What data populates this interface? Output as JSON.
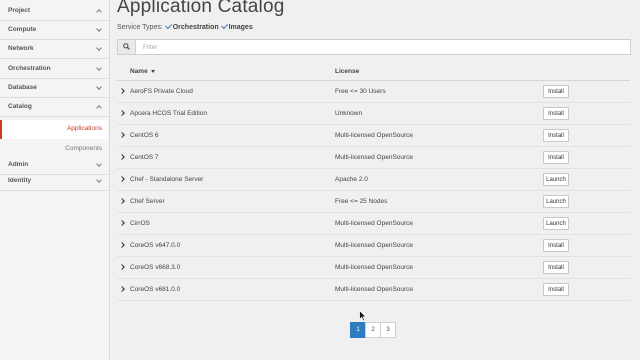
{
  "sidebar": {
    "project": "Project",
    "compute": "Compute",
    "network": "Network",
    "orchestration": "Orchestration",
    "database": "Database",
    "catalog": "Catalog",
    "catalog_items": [
      "Applications",
      "Components"
    ],
    "admin": "Admin",
    "identity": "Identity"
  },
  "main": {
    "title": "Application Catalog",
    "service_types_label": "Service Types:",
    "service_types": [
      "Orchestration",
      "Images"
    ],
    "filter_placeholder": "Filter"
  },
  "table": {
    "headers": {
      "name": "Name",
      "license": "License"
    },
    "rows": [
      {
        "name": "AeroFS Private Cloud",
        "license": "Free <= 30 Users",
        "action": "Install"
      },
      {
        "name": "Apcera HCOS Trial Edition",
        "license": "Unknown",
        "action": "Install"
      },
      {
        "name": "CentOS 6",
        "license": "Multi-licensed OpenSource",
        "action": "Install"
      },
      {
        "name": "CentOS 7",
        "license": "Multi-licensed OpenSource",
        "action": "Install"
      },
      {
        "name": "Chef - Standalone Server",
        "license": "Apache 2.0",
        "action": "Launch"
      },
      {
        "name": "Chef Server",
        "license": "Free <= 25 Nodes",
        "action": "Launch"
      },
      {
        "name": "CirrOS",
        "license": "Multi-licensed OpenSource",
        "action": "Launch"
      },
      {
        "name": "CoreOS v647.0.0",
        "license": "Multi-licensed OpenSource",
        "action": "Install"
      },
      {
        "name": "CoreOS v668.3.0",
        "license": "Multi-licensed OpenSource",
        "action": "Install"
      },
      {
        "name": "CoreOS v681.0.0",
        "license": "Multi-licensed OpenSource",
        "action": "Install"
      }
    ]
  },
  "pagination": {
    "pages": [
      "1",
      "2",
      "3"
    ],
    "current": "1"
  },
  "colors": {
    "accent": "#c83b24",
    "primary": "#2e7bbf"
  },
  "icons": {
    "filter": "search-icon",
    "expand": "chevron-right-icon",
    "section": "chevron-down-icon"
  }
}
